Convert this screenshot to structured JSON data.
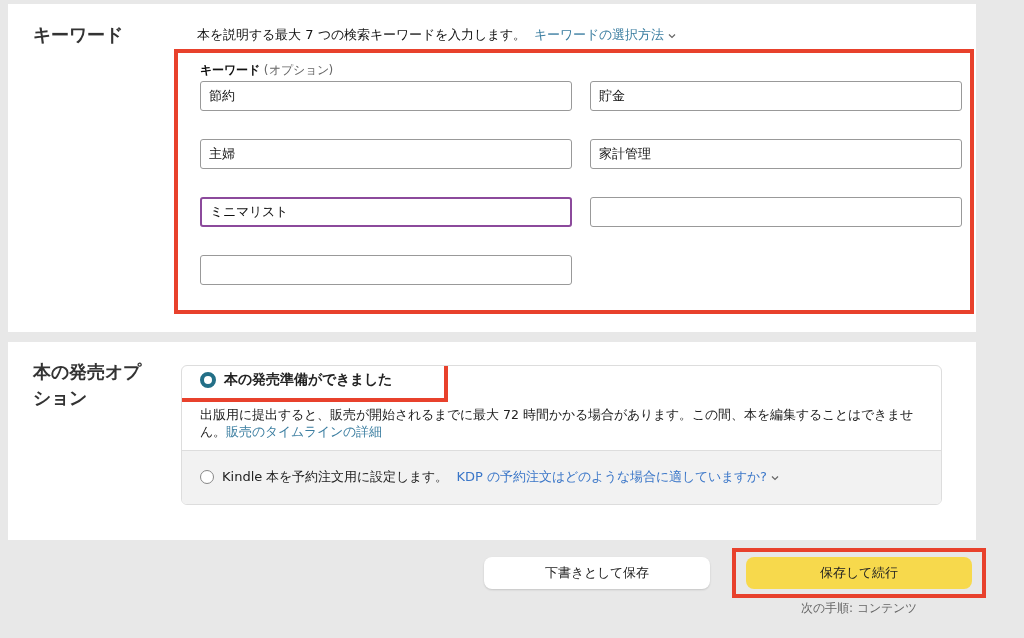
{
  "keywords_section": {
    "title": "キーワード",
    "description": "本を説明する最大 7 つの検索キーワードを入力します。",
    "help_link": "キーワードの選択方法",
    "group": {
      "label": "キーワード",
      "hint": "(オプション)",
      "highlighted": true,
      "fields": [
        {
          "value": "節約",
          "focused": false
        },
        {
          "value": "貯金",
          "focused": false
        },
        {
          "value": "主婦",
          "focused": false
        },
        {
          "value": "家計管理",
          "focused": false
        },
        {
          "value": "ミニマリスト",
          "focused": true
        },
        {
          "focused": false
        },
        {
          "focused": false
        }
      ]
    }
  },
  "release_section": {
    "title": "本の発売オプション",
    "options": [
      {
        "label": "本の発売準備ができました",
        "selected": true,
        "highlighted": true,
        "description": "出版用に提出すると、販売が開始されるまでに最大 72 時間かかる場合があります。この間、本を編集することはできません。",
        "link": "販売のタイムラインの詳細"
      },
      {
        "label": "Kindle 本を予約注文用に設定します。",
        "selected": false,
        "highlighted": false,
        "link": "KDP の予約注文はどのような場合に適していますか?"
      }
    ]
  },
  "actions": [
    {
      "label": "下書きとして保存",
      "kind": "secondary",
      "highlighted": false
    },
    {
      "label": "保存して続行",
      "kind": "primary",
      "highlighted": true,
      "caption": "次の手順: コンテンツ"
    }
  ]
}
